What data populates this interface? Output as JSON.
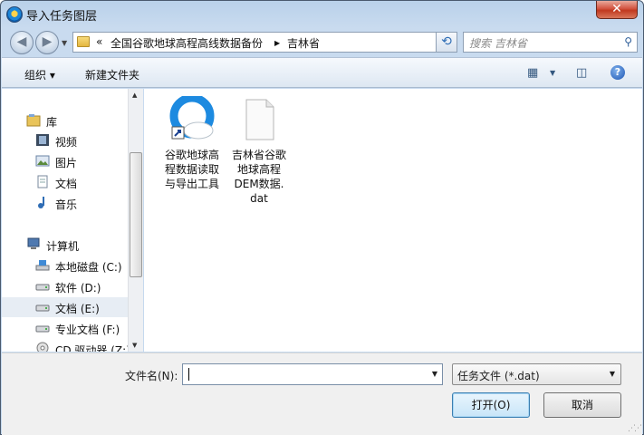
{
  "window": {
    "title": "导入任务图层",
    "close_glyph": "✕"
  },
  "address": {
    "back_glyph": "◀",
    "forward_glyph": "▶",
    "overflow": "«",
    "crumbs": [
      "全国谷歌地球高程高线数据备份",
      "吉林省"
    ],
    "separator": "▶"
  },
  "search": {
    "placeholder": "搜索 吉林省"
  },
  "toolbar": {
    "organize": "组织 ▾",
    "new_folder": "新建文件夹"
  },
  "sidebar": {
    "items": [
      {
        "label": "库",
        "icon": "library-icon"
      },
      {
        "label": "视频",
        "icon": "video-icon"
      },
      {
        "label": "图片",
        "icon": "picture-icon"
      },
      {
        "label": "文档",
        "icon": "document-icon"
      },
      {
        "label": "音乐",
        "icon": "music-icon"
      },
      {
        "label": "计算机",
        "icon": "computer-icon"
      },
      {
        "label": "本地磁盘 (C:)",
        "icon": "system-drive-icon"
      },
      {
        "label": "软件 (D:)",
        "icon": "drive-icon"
      },
      {
        "label": "文档 (E:)",
        "icon": "drive-icon"
      },
      {
        "label": "专业文档 (F:)",
        "icon": "drive-icon"
      },
      {
        "label": "CD 驱动器 (Z:)",
        "icon": "cd-drive-icon"
      }
    ]
  },
  "files": [
    {
      "name_lines": [
        "谷歌地球高",
        "程数据读取",
        "与导出工具"
      ],
      "icon": "app-shortcut-icon"
    },
    {
      "name_lines": [
        "吉林省谷歌",
        "地球高程",
        "DEM数据.",
        "dat"
      ],
      "icon": "dat-file-icon"
    }
  ],
  "footer": {
    "filename_label": "文件名(N):",
    "filename_value": "",
    "filetype_selected": "任务文件 (*.dat)",
    "open_button": "打开(O)",
    "cancel_button": "取消"
  },
  "colors": {
    "accent": "#1d86d8",
    "selected_row": "#e7edf4"
  }
}
